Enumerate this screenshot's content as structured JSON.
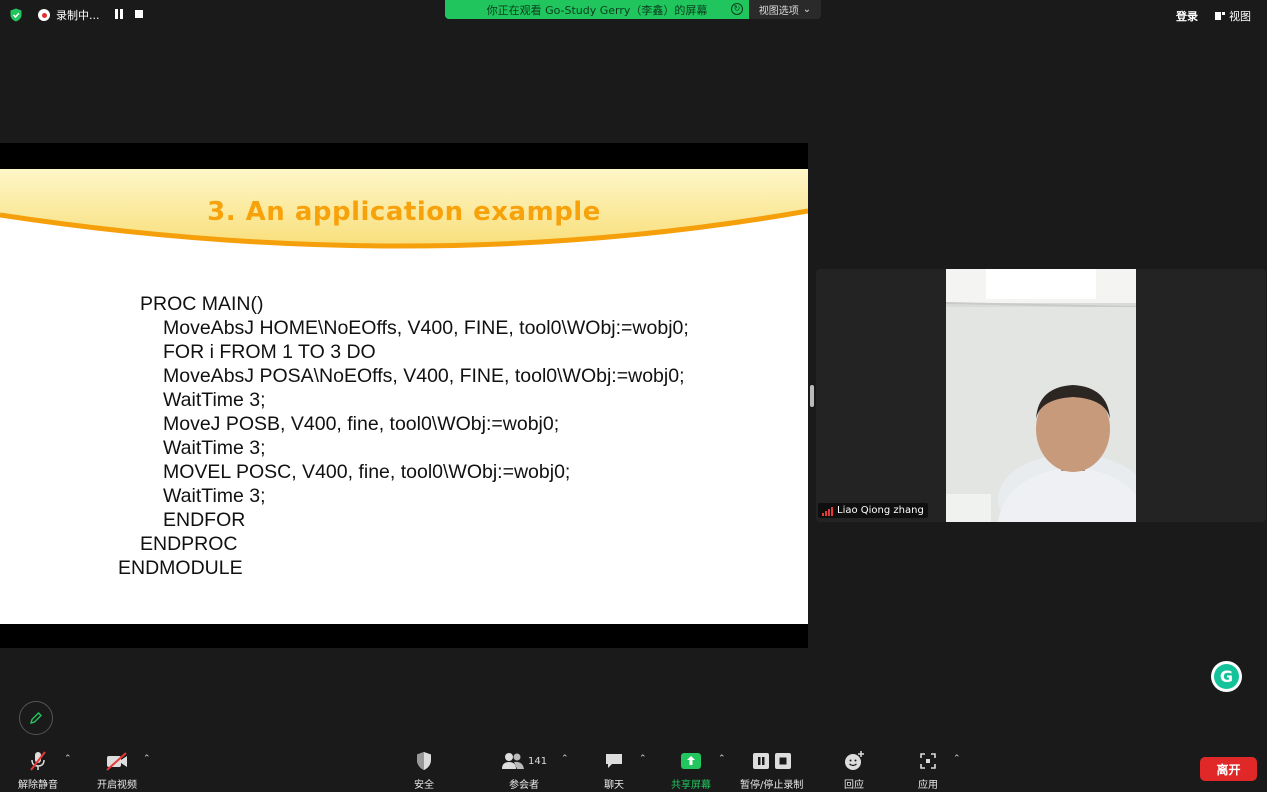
{
  "topbar": {
    "recording_label": "录制中...",
    "banner_text": "你正在观看 Go-Study Gerry（李鑫）的屏幕",
    "view_options": "视图选项",
    "login": "登录",
    "view": "视图"
  },
  "slide": {
    "title": "3. An application example",
    "code_lines": [
      "PROC MAIN()",
      "MoveAbsJ HOME\\NoEOffs, V400, FINE, tool0\\WObj:=wobj0;",
      "FOR i FROM 1 TO 3 DO",
      "MoveAbsJ POSA\\NoEOffs, V400, FINE, tool0\\WObj:=wobj0;",
      "WaitTime 3;",
      "MoveJ POSB, V400, fine, tool0\\WObj:=wobj0;",
      "WaitTime 3;",
      "MOVEL POSC, V400, fine, tool0\\WObj:=wobj0;",
      "WaitTime 3;",
      "ENDFOR",
      "ENDPROC",
      "ENDMODULE"
    ]
  },
  "participant": {
    "name": "Liao Qiong zhang"
  },
  "toolbar": {
    "unmute": "解除静音",
    "start_video": "开启视频",
    "security": "安全",
    "participants": "参会者",
    "participants_count": "141",
    "chat": "聊天",
    "share_screen": "共享屏幕",
    "pause_stop_recording": "暂停/停止录制",
    "reactions": "回应",
    "apps": "应用",
    "leave": "离开"
  },
  "colors": {
    "accent_green": "#21c55d",
    "leave_red": "#e02828",
    "slide_title_orange": "#f7a20b"
  }
}
